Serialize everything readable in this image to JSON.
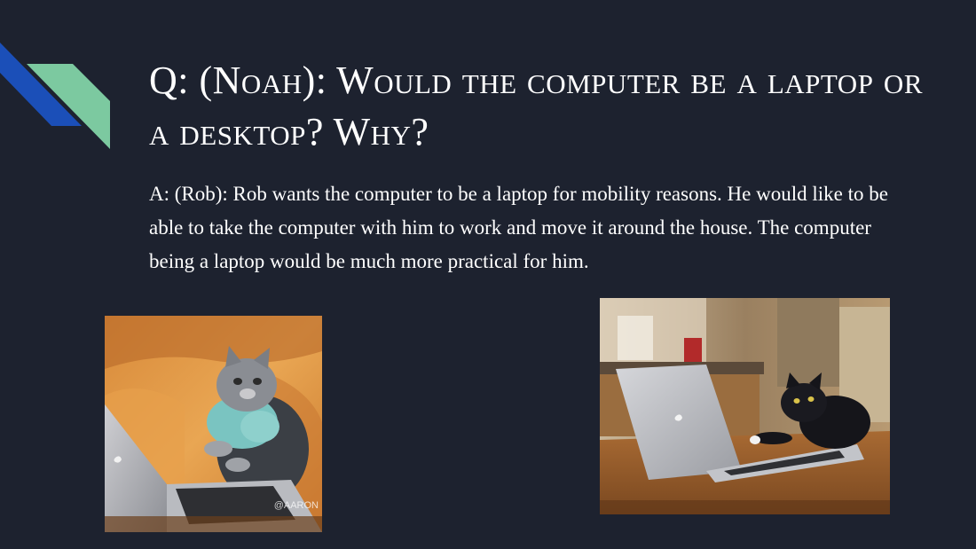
{
  "slide": {
    "title": "Q: (Noah): Would the computer be a laptop or a desktop? Why?",
    "body": "A: (Rob): Rob wants the computer to be a laptop for mobility reasons. He would like to be able to take the computer with him to work and move it around the house. The computer being a laptop would be much more practical for him."
  },
  "images": {
    "left": {
      "icon": "cat-typing-on-laptop",
      "watermark": "@AARON"
    },
    "right": {
      "icon": "black-cat-typing-on-laptop"
    }
  },
  "colors": {
    "background": "#1d222f",
    "accent_blue": "#1b4fb8",
    "accent_green": "#7cc9a0",
    "text": "#ffffff"
  }
}
